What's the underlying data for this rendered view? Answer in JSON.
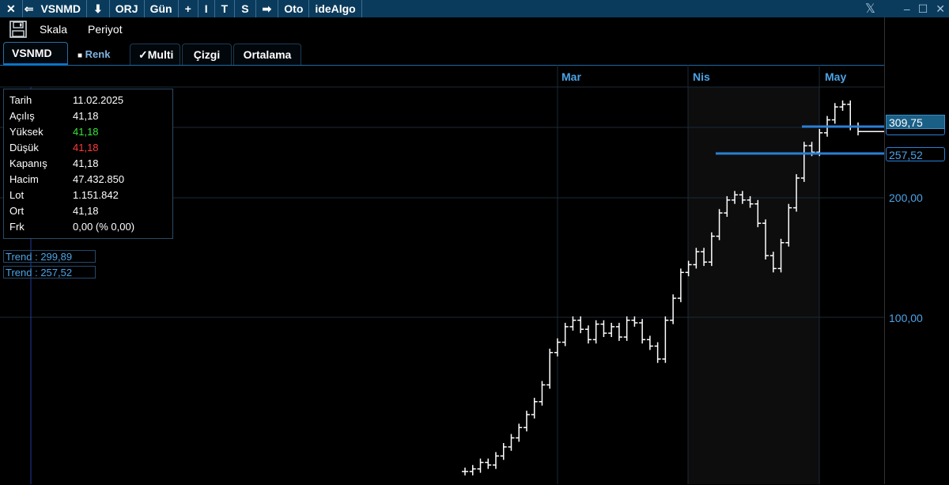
{
  "titlebar": {
    "close_glyph": "✕",
    "back_glyph": "⇐",
    "symbol": "VSNMD",
    "down_glyph": "⬇",
    "orj": "ORJ",
    "period": "Gün",
    "plus": "+",
    "i": "I",
    "t": "T",
    "s": "S",
    "arrow": "➡",
    "oto": "Oto",
    "idealgo": "ideAlgo",
    "x_logo": "𝕏",
    "min_glyph": "‒",
    "max_glyph": "☐",
    "close2_glyph": "✕"
  },
  "toolbar": {
    "scale_label": "Skala",
    "period_label": "Periyot"
  },
  "tabs": [
    {
      "label": "VSNMD"
    },
    {
      "label": "Renk",
      "prefix": "■"
    },
    {
      "label": "Multi",
      "prefix": "✓"
    },
    {
      "label": "Çizgi"
    },
    {
      "label": "Ortalama"
    }
  ],
  "info": {
    "rows": [
      {
        "key": "Tarih",
        "value": "11.02.2025",
        "color": "#ffffff"
      },
      {
        "key": "Açılış",
        "value": "41,18",
        "color": "#ffffff"
      },
      {
        "key": "Yüksek",
        "value": "41,18",
        "color": "#39e639"
      },
      {
        "key": "Düşük",
        "value": "41,18",
        "color": "#ff3b3b"
      },
      {
        "key": "Kapanış",
        "value": "41,18",
        "color": "#ffffff"
      },
      {
        "key": "Hacim",
        "value": "47.432.850",
        "color": "#ffffff"
      },
      {
        "key": "Lot",
        "value": "1.151.842",
        "color": "#ffffff"
      },
      {
        "key": "Ort",
        "value": "41,18",
        "color": "#ffffff"
      },
      {
        "key": "Frk",
        "value": "0,00 (% 0,00)",
        "color": "#ffffff"
      }
    ]
  },
  "trends": [
    "Trend : 299,89",
    "Trend : 257,52"
  ],
  "chart_data": {
    "type": "line",
    "x_ticks": [
      "Mar",
      "Nis",
      "May"
    ],
    "y_ticks": [
      "200,00",
      "100,00"
    ],
    "price_labels": [
      "309,75",
      "257,52"
    ],
    "series": [
      {
        "values": [
          48,
          50,
          55,
          53,
          60,
          67,
          74,
          82,
          92,
          102,
          115,
          140,
          148,
          160,
          165,
          158,
          150,
          162,
          155,
          160,
          152,
          165,
          163,
          150,
          145,
          135,
          165,
          182,
          202,
          208,
          218,
          210,
          230,
          248,
          258,
          262,
          258,
          255,
          240,
          215,
          205,
          225,
          252,
          275,
          300,
          295,
          310,
          320,
          330,
          332,
          315,
          311
        ]
      }
    ],
    "colors": {
      "candle": "#ffffff",
      "trend_line": "#2a7fd4",
      "axis_text": "#4da3e6",
      "last_price_bg": "#1a5f86"
    }
  }
}
